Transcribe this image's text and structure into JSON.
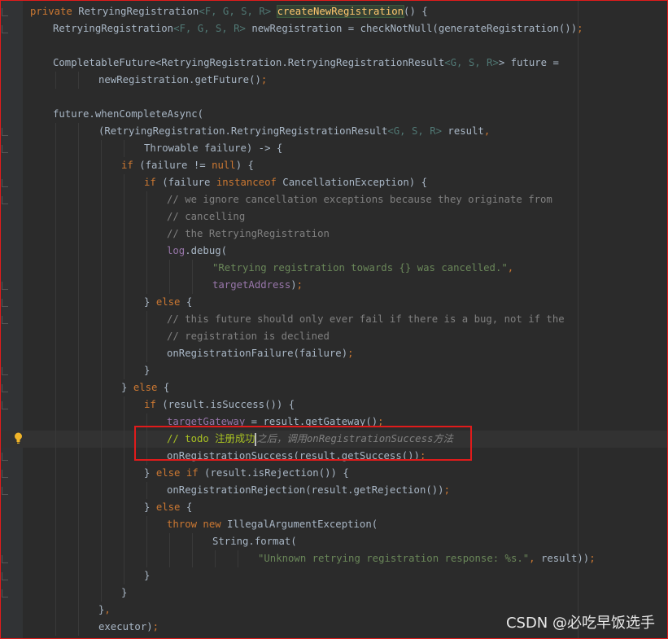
{
  "editor": {
    "colors": {
      "background": "#2b2b2b",
      "keyword": "#cc7832",
      "text": "#a9b7c6",
      "comment": "#808080",
      "string": "#6a8759",
      "field": "#9876aa",
      "todo": "#a8c023",
      "highlight_box": "#e01b1b"
    },
    "current_line": 26,
    "caret_after": "注册成功",
    "lines": [
      {
        "indent": 4,
        "tokens": [
          [
            "kw",
            "private "
          ],
          [
            "t",
            "RetryingRegistration"
          ],
          [
            "gen",
            "<F, G, S, R>"
          ],
          [
            "t",
            " "
          ],
          [
            "fn",
            "createNewRegistration"
          ],
          [
            "t",
            "() {"
          ]
        ]
      },
      {
        "indent": 8,
        "tokens": [
          [
            "t",
            "RetryingRegistration"
          ],
          [
            "gen",
            "<F, G, S, R>"
          ],
          [
            "t",
            " newRegistration = checkNotNull(generateRegistration())"
          ],
          [
            "semi",
            ";"
          ]
        ]
      },
      {
        "indent": 0,
        "tokens": []
      },
      {
        "indent": 8,
        "tokens": [
          [
            "t",
            "CompletableFuture<RetryingRegistration.RetryingRegistrationResult"
          ],
          [
            "gen",
            "<G, S, R>"
          ],
          [
            "t",
            "> future ="
          ]
        ]
      },
      {
        "indent": 16,
        "tokens": [
          [
            "t",
            "newRegistration.getFuture()"
          ],
          [
            "semi",
            ";"
          ]
        ]
      },
      {
        "indent": 0,
        "tokens": []
      },
      {
        "indent": 8,
        "tokens": [
          [
            "t",
            "future.whenCompleteAsync("
          ]
        ]
      },
      {
        "indent": 16,
        "tokens": [
          [
            "t",
            "(RetryingRegistration.RetryingRegistrationResult"
          ],
          [
            "gen",
            "<G, S, R>"
          ],
          [
            "t",
            " result"
          ],
          [
            "semi",
            ","
          ]
        ]
      },
      {
        "indent": 24,
        "tokens": [
          [
            "t",
            "Throwable failure) -> {"
          ]
        ]
      },
      {
        "indent": 20,
        "tokens": [
          [
            "kw",
            "if "
          ],
          [
            "t",
            "(failure != "
          ],
          [
            "kw",
            "null"
          ],
          [
            "t",
            ") {"
          ]
        ]
      },
      {
        "indent": 24,
        "tokens": [
          [
            "kw",
            "if "
          ],
          [
            "t",
            "(failure "
          ],
          [
            "kw",
            "instanceof "
          ],
          [
            "t",
            "CancellationException) {"
          ]
        ]
      },
      {
        "indent": 28,
        "tokens": [
          [
            "cmt",
            "// we ignore cancellation exceptions because they originate from"
          ]
        ]
      },
      {
        "indent": 28,
        "tokens": [
          [
            "cmt",
            "// cancelling"
          ]
        ]
      },
      {
        "indent": 28,
        "tokens": [
          [
            "cmt",
            "// the RetryingRegistration"
          ]
        ]
      },
      {
        "indent": 28,
        "tokens": [
          [
            "field",
            "log"
          ],
          [
            "t",
            ".debug("
          ]
        ]
      },
      {
        "indent": 36,
        "tokens": [
          [
            "str",
            "\"Retrying registration towards {} was cancelled.\""
          ],
          [
            "semi",
            ","
          ]
        ]
      },
      {
        "indent": 36,
        "tokens": [
          [
            "field",
            "targetAddress"
          ],
          [
            "t",
            ")"
          ],
          [
            "semi",
            ";"
          ]
        ]
      },
      {
        "indent": 24,
        "tokens": [
          [
            "t",
            "} "
          ],
          [
            "kw",
            "else "
          ],
          [
            "t",
            "{"
          ]
        ]
      },
      {
        "indent": 28,
        "tokens": [
          [
            "cmt",
            "// this future should only ever fail if there is a bug, not if the"
          ]
        ]
      },
      {
        "indent": 28,
        "tokens": [
          [
            "cmt",
            "// registration is declined"
          ]
        ]
      },
      {
        "indent": 28,
        "tokens": [
          [
            "t",
            "onRegistrationFailure(failure)"
          ],
          [
            "semi",
            ";"
          ]
        ]
      },
      {
        "indent": 24,
        "tokens": [
          [
            "t",
            "}"
          ]
        ]
      },
      {
        "indent": 20,
        "tokens": [
          [
            "t",
            "} "
          ],
          [
            "kw",
            "else "
          ],
          [
            "t",
            "{"
          ]
        ]
      },
      {
        "indent": 24,
        "tokens": [
          [
            "kw",
            "if "
          ],
          [
            "t",
            "(result.isSuccess()) {"
          ]
        ]
      },
      {
        "indent": 28,
        "tokens": [
          [
            "field",
            "targetGateway"
          ],
          [
            "t",
            " = result.getGateway()"
          ],
          [
            "semi",
            ";"
          ]
        ]
      },
      {
        "indent": 28,
        "tokens": [
          [
            "todo",
            "// todo 注册成功"
          ],
          [
            "caret",
            ""
          ],
          [
            "icmt",
            "之后，调用onRegistrationSuccess方法"
          ]
        ]
      },
      {
        "indent": 28,
        "tokens": [
          [
            "t",
            "onRegistrationSuccess(result.getSuccess())"
          ],
          [
            "semi",
            ";"
          ]
        ]
      },
      {
        "indent": 24,
        "tokens": [
          [
            "t",
            "} "
          ],
          [
            "kw",
            "else if "
          ],
          [
            "t",
            "(result.isRejection()) {"
          ]
        ]
      },
      {
        "indent": 28,
        "tokens": [
          [
            "t",
            "onRegistrationRejection(result.getRejection())"
          ],
          [
            "semi",
            ";"
          ]
        ]
      },
      {
        "indent": 24,
        "tokens": [
          [
            "t",
            "} "
          ],
          [
            "kw",
            "else "
          ],
          [
            "t",
            "{"
          ]
        ]
      },
      {
        "indent": 28,
        "tokens": [
          [
            "kw",
            "throw new "
          ],
          [
            "t",
            "IllegalArgumentException("
          ]
        ]
      },
      {
        "indent": 36,
        "tokens": [
          [
            "t",
            "String."
          ],
          [
            "t",
            "format("
          ]
        ]
      },
      {
        "indent": 44,
        "tokens": [
          [
            "str",
            "\"Unknown retrying registration response: %s.\""
          ],
          [
            "semi",
            ", "
          ],
          [
            "t",
            "result))"
          ],
          [
            "semi",
            ";"
          ]
        ]
      },
      {
        "indent": 24,
        "tokens": [
          [
            "t",
            "}"
          ]
        ]
      },
      {
        "indent": 20,
        "tokens": [
          [
            "t",
            "}"
          ]
        ]
      },
      {
        "indent": 16,
        "tokens": [
          [
            "t",
            "}"
          ],
          [
            "semi",
            ","
          ]
        ]
      },
      {
        "indent": 16,
        "tokens": [
          [
            "t",
            "executor)"
          ],
          [
            "semi",
            ";"
          ]
        ]
      }
    ]
  },
  "gutter": {
    "intention_icon": "lightbulb-icon"
  },
  "watermark": "CSDN @必吃早饭选手"
}
